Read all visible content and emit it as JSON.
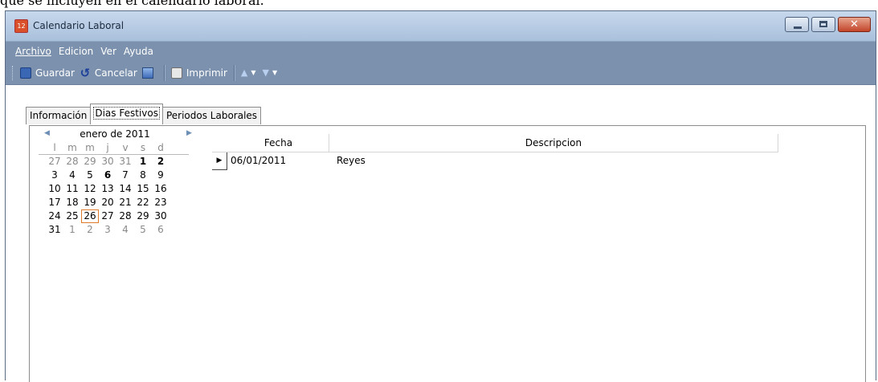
{
  "above_text": "que se incluyen en el calendario laboral.",
  "window": {
    "title": "Calendario Laboral",
    "app_icon_text": "12"
  },
  "menu": {
    "items": [
      {
        "label": "Archivo"
      },
      {
        "label": "Edicion"
      },
      {
        "label": "Ver"
      },
      {
        "label": "Ayuda"
      }
    ]
  },
  "toolbar": {
    "save_label": "Guardar",
    "cancel_label": "Cancelar",
    "print_label": "Imprimir"
  },
  "tabs": [
    {
      "label": "Información"
    },
    {
      "label": "Dias Festivos"
    },
    {
      "label": "Periodos Laborales"
    }
  ],
  "calendar": {
    "month_title": "enero de 2011",
    "weekdays": [
      "l",
      "m",
      "m",
      "j",
      "v",
      "s",
      "d"
    ],
    "weeks": [
      [
        "27",
        "28",
        "29",
        "30",
        "31",
        "1",
        "2"
      ],
      [
        "3",
        "4",
        "5",
        "6",
        "7",
        "8",
        "9"
      ],
      [
        "10",
        "11",
        "12",
        "13",
        "14",
        "15",
        "16"
      ],
      [
        "17",
        "18",
        "19",
        "20",
        "21",
        "22",
        "23"
      ],
      [
        "24",
        "25",
        "26",
        "27",
        "28",
        "29",
        "30"
      ],
      [
        "31",
        "1",
        "2",
        "3",
        "4",
        "5",
        "6"
      ]
    ],
    "today": "26",
    "holiday": "6"
  },
  "grid": {
    "columns": [
      "Fecha",
      "Descripcion"
    ],
    "rows": [
      {
        "fecha": "06/01/2011",
        "descripcion": "Reyes"
      }
    ]
  }
}
